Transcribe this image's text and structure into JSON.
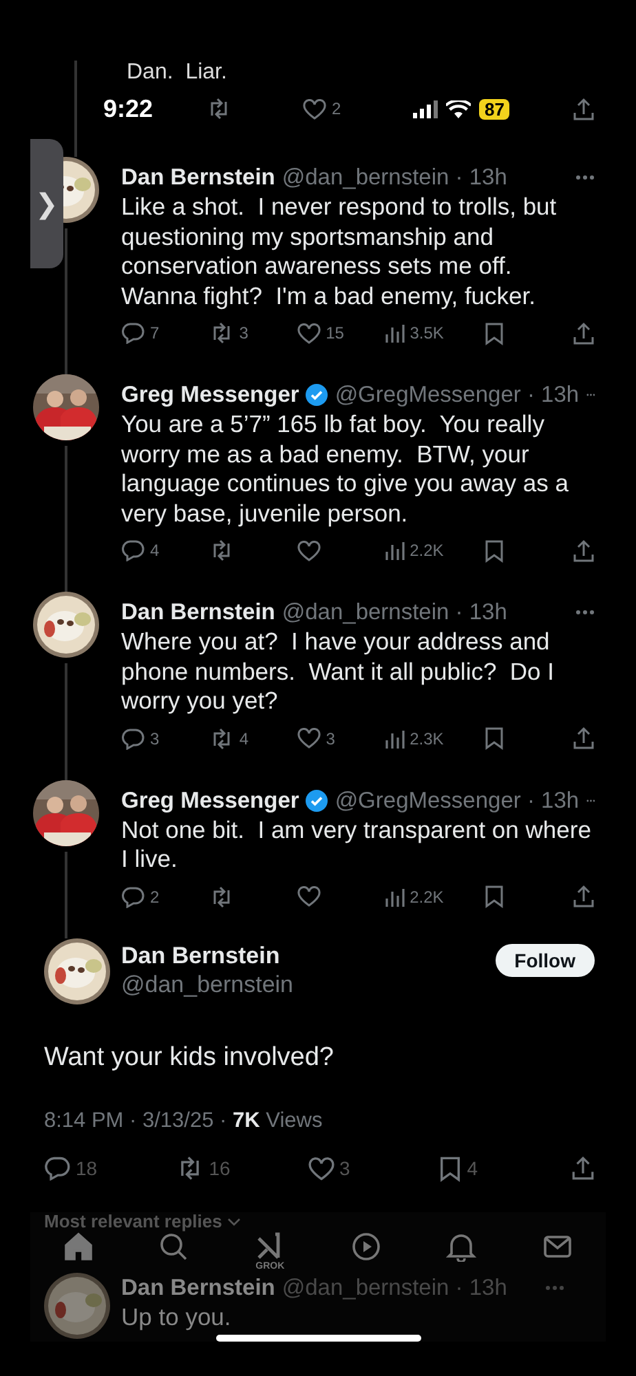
{
  "previous_tweet": {
    "text_fragment": "Dan.  Liar.",
    "actions": [
      {
        "kind": "retweet"
      },
      {
        "kind": "like",
        "count": "2"
      },
      {
        "kind": "share"
      }
    ]
  },
  "status_bar": {
    "time": "9:22",
    "battery": "87"
  },
  "side_handle": {
    "glyph": "❯"
  },
  "replies": [
    {
      "name": "Dan Bernstein",
      "verified": false,
      "byline": "@dan_bernstein · 13h",
      "text": "Like a shot.  I never respond to trolls, but questioning my sportsmanship and conservation awareness sets me off.  Wanna fight?  I'm a bad enemy, fucker.",
      "actions": [
        {
          "kind": "reply",
          "count": "7"
        },
        {
          "kind": "retweet",
          "count": "3"
        },
        {
          "kind": "like",
          "count": "15"
        },
        {
          "kind": "views",
          "count": "3.5K"
        },
        {
          "kind": "bookmark"
        },
        {
          "kind": "share"
        }
      ]
    },
    {
      "name": "Greg Messenger",
      "verified": true,
      "byline": "@GregMessenger · 13h",
      "text": "You are a 5’7” 165 lb fat boy.  You really worry me as a bad enemy.  BTW, your language continues to give you away as a very base, juvenile person.",
      "actions": [
        {
          "kind": "reply",
          "count": "4"
        },
        {
          "kind": "retweet"
        },
        {
          "kind": "like"
        },
        {
          "kind": "views",
          "count": "2.2K"
        },
        {
          "kind": "bookmark"
        },
        {
          "kind": "share"
        }
      ]
    },
    {
      "name": "Dan Bernstein",
      "verified": false,
      "byline": "@dan_bernstein · 13h",
      "text": "Where you at?  I have your address and phone numbers.  Want it all public?  Do I worry you yet?",
      "actions": [
        {
          "kind": "reply",
          "count": "3"
        },
        {
          "kind": "retweet",
          "count": "4"
        },
        {
          "kind": "like",
          "count": "3"
        },
        {
          "kind": "views",
          "count": "2.3K"
        },
        {
          "kind": "bookmark"
        },
        {
          "kind": "share"
        }
      ]
    },
    {
      "name": "Greg Messenger",
      "verified": true,
      "byline": "@GregMessenger · 13h",
      "text": "Not one bit.  I am very transparent on where I live.",
      "actions": [
        {
          "kind": "reply",
          "count": "2"
        },
        {
          "kind": "retweet"
        },
        {
          "kind": "like"
        },
        {
          "kind": "views",
          "count": "2.2K"
        },
        {
          "kind": "bookmark"
        },
        {
          "kind": "share"
        }
      ]
    }
  ],
  "main_tweet": {
    "name": "Dan Bernstein",
    "handle": "@dan_bernstein",
    "follow_button": "Follow",
    "text": "Want your kids involved?",
    "meta": "8:14 PM · 3/13/25 · **7K** Views",
    "actions": [
      {
        "kind": "reply",
        "count": "18"
      },
      {
        "kind": "retweet",
        "count": "16"
      },
      {
        "kind": "like",
        "count": "3"
      },
      {
        "kind": "bookmark",
        "count": "4"
      },
      {
        "kind": "share"
      }
    ]
  },
  "sort": {
    "label": "Most relevant replies"
  },
  "tab_bar": [
    {
      "kind": "home",
      "selected": true
    },
    {
      "kind": "search",
      "selected": false
    },
    {
      "kind": "grok",
      "label": "GROK",
      "selected": false
    },
    {
      "kind": "video",
      "selected": false
    },
    {
      "kind": "notifications",
      "selected": false
    },
    {
      "kind": "messages",
      "selected": false
    }
  ],
  "last_reply": {
    "name": "Dan Bernstein",
    "byline": "@dan_bernstein · 13h",
    "text": "Up to you."
  }
}
